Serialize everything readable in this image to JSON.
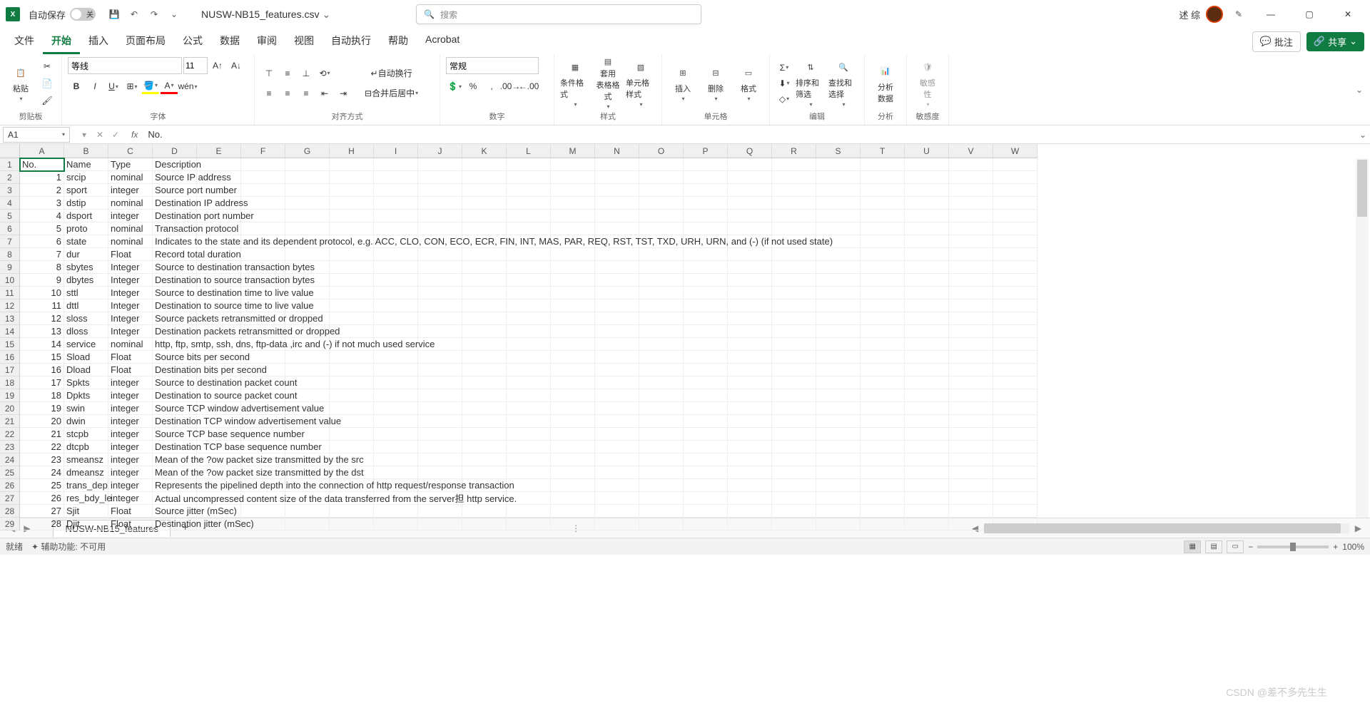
{
  "title_bar": {
    "app_initial": "X",
    "autosave_label": "自动保存",
    "filename": "NUSW-NB15_features.csv",
    "search_placeholder": "搜索",
    "user_name": "述 综"
  },
  "ribbon_tabs": [
    "文件",
    "开始",
    "插入",
    "页面布局",
    "公式",
    "数据",
    "审阅",
    "视图",
    "自动执行",
    "帮助",
    "Acrobat"
  ],
  "ribbon_active": "开始",
  "ribbon_right": {
    "comments": "批注",
    "share": "共享"
  },
  "ribbon_groups": {
    "clipboard": {
      "paste": "粘贴",
      "label": "剪贴板"
    },
    "font": {
      "name": "等线",
      "size": "11",
      "wen": "wén",
      "label": "字体"
    },
    "align": {
      "wrap": "自动换行",
      "merge": "合并后居中",
      "label": "对齐方式"
    },
    "number": {
      "format": "常规",
      "label": "数字"
    },
    "styles": {
      "cond": "条件格式",
      "table": "套用\n表格格式",
      "cell": "单元格样式",
      "label": "样式"
    },
    "cells": {
      "insert": "插入",
      "delete": "删除",
      "format": "格式",
      "label": "单元格"
    },
    "editing": {
      "sort": "排序和筛选",
      "find": "查找和选择",
      "label": "编辑"
    },
    "analysis": {
      "analyze": "分析\n数据",
      "label": "分析"
    },
    "sensitivity": {
      "sens": "敏感\n性",
      "label": "敏感度"
    }
  },
  "formula": {
    "name_box": "A1",
    "value": "No."
  },
  "columns": [
    "A",
    "B",
    "C",
    "D",
    "E",
    "F",
    "G",
    "H",
    "I",
    "J",
    "K",
    "L",
    "M",
    "N",
    "O",
    "P",
    "Q",
    "R",
    "S",
    "T",
    "U",
    "V",
    "W"
  ],
  "row_numbers": [
    1,
    2,
    3,
    4,
    5,
    6,
    7,
    8,
    9,
    10,
    11,
    12,
    13,
    14,
    15,
    16,
    17,
    18,
    19,
    20,
    21,
    22,
    23,
    24,
    25,
    26,
    27,
    28,
    29
  ],
  "header_row": [
    "No.",
    "Name",
    "Type",
    "Description"
  ],
  "rows": [
    {
      "n": "1",
      "name": "srcip",
      "type": "nominal",
      "desc": "Source IP address"
    },
    {
      "n": "2",
      "name": "sport",
      "type": "integer",
      "desc": "Source port number"
    },
    {
      "n": "3",
      "name": "dstip",
      "type": "nominal",
      "desc": "Destination IP address"
    },
    {
      "n": "4",
      "name": "dsport",
      "type": "integer",
      "desc": "Destination port number"
    },
    {
      "n": "5",
      "name": "proto",
      "type": "nominal",
      "desc": "Transaction protocol"
    },
    {
      "n": "6",
      "name": "state",
      "type": "nominal",
      "desc": "Indicates to the state and its dependent protocol, e.g. ACC, CLO, CON, ECO, ECR, FIN, INT, MAS, PAR, REQ, RST, TST, TXD, URH, URN, and (-) (if not used state)"
    },
    {
      "n": "7",
      "name": "dur",
      "type": "Float",
      "desc": "Record total duration"
    },
    {
      "n": "8",
      "name": "sbytes",
      "type": "Integer",
      "desc": "Source to destination transaction bytes"
    },
    {
      "n": "9",
      "name": "dbytes",
      "type": "Integer",
      "desc": "Destination to source transaction bytes"
    },
    {
      "n": "10",
      "name": "sttl",
      "type": "Integer",
      "desc": "Source to destination time to live value"
    },
    {
      "n": "11",
      "name": "dttl",
      "type": "Integer",
      "desc": "Destination to source time to live value"
    },
    {
      "n": "12",
      "name": "sloss",
      "type": "Integer",
      "desc": "Source packets retransmitted or dropped"
    },
    {
      "n": "13",
      "name": "dloss",
      "type": "Integer",
      "desc": "Destination packets retransmitted or dropped"
    },
    {
      "n": "14",
      "name": "service",
      "type": "nominal",
      "desc": "http, ftp, smtp, ssh, dns, ftp-data ,irc  and (-) if not much used service"
    },
    {
      "n": "15",
      "name": "Sload",
      "type": "Float",
      "desc": "Source bits per second"
    },
    {
      "n": "16",
      "name": "Dload",
      "type": "Float",
      "desc": "Destination bits per second"
    },
    {
      "n": "17",
      "name": "Spkts",
      "type": "integer",
      "desc": "Source to destination packet count"
    },
    {
      "n": "18",
      "name": "Dpkts",
      "type": "integer",
      "desc": "Destination to source packet count"
    },
    {
      "n": "19",
      "name": "swin",
      "type": "integer",
      "desc": "Source TCP window advertisement value"
    },
    {
      "n": "20",
      "name": "dwin",
      "type": "integer",
      "desc": "Destination TCP window advertisement value"
    },
    {
      "n": "21",
      "name": "stcpb",
      "type": "integer",
      "desc": "Source TCP base sequence number"
    },
    {
      "n": "22",
      "name": "dtcpb",
      "type": "integer",
      "desc": "Destination TCP base sequence number"
    },
    {
      "n": "23",
      "name": "smeansz",
      "type": "integer",
      "desc": "Mean of the ?ow packet size transmitted by the src"
    },
    {
      "n": "24",
      "name": "dmeansz",
      "type": "integer",
      "desc": "Mean of the ?ow packet size transmitted by the dst"
    },
    {
      "n": "25",
      "name": "trans_dep",
      "type": "integer",
      "desc": "Represents the pipelined depth into the connection of http request/response transaction"
    },
    {
      "n": "26",
      "name": "res_bdy_le",
      "type": "integer",
      "desc": "Actual uncompressed content size of the data transferred from the server担 http service."
    },
    {
      "n": "27",
      "name": "Sjit",
      "type": "Float",
      "desc": "Source jitter (mSec)"
    },
    {
      "n": "28",
      "name": "Djit",
      "type": "Float",
      "desc": "Destination jitter (mSec)"
    }
  ],
  "sheet": {
    "name": "NUSW-NB15_features"
  },
  "status": {
    "ready": "就绪",
    "access": "辅助功能: 不可用",
    "zoom": "100%"
  },
  "watermark": "CSDN @差不多先生生"
}
